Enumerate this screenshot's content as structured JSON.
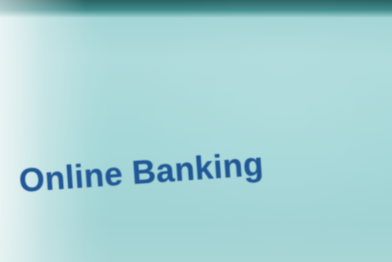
{
  "page": {
    "title": "Online Banking"
  },
  "colors": {
    "screen_background": "#a6d8d9",
    "top_frame": "#2a6364",
    "title_text": "#1f5797"
  }
}
